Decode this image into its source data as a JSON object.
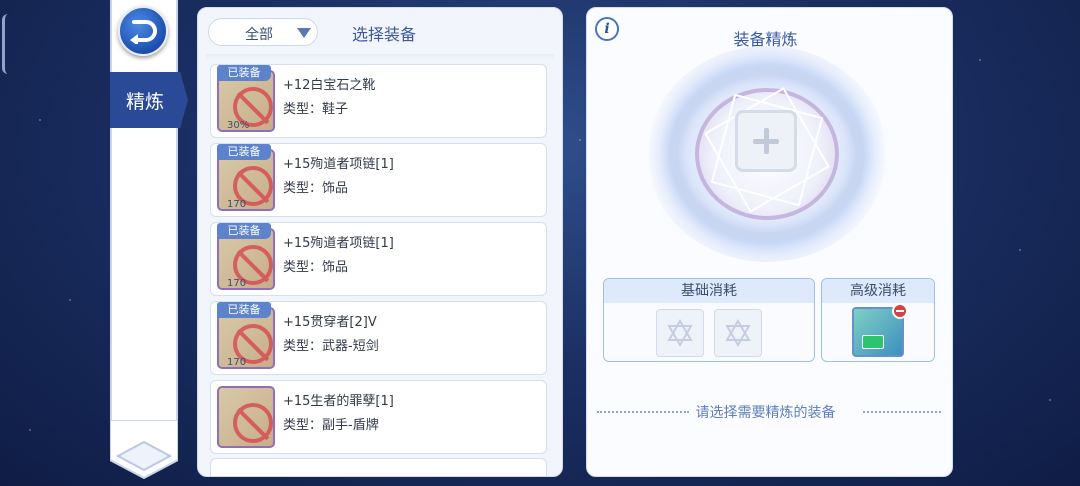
{
  "colors": {
    "accent": "#2a4a98",
    "panel_title": "#3b5a9e",
    "equipped_badge": "#5c83cc"
  },
  "sidebar": {
    "back_icon": "back-arrow-icon",
    "tab_label": "精炼"
  },
  "list": {
    "filter_value": "全部",
    "title": "选择装备",
    "items": [
      {
        "badge": "已装备",
        "name": "+12白宝石之靴",
        "type": "类型：鞋子",
        "level": "30%"
      },
      {
        "badge": "已装备",
        "name": "+15殉道者项链[1]",
        "type": "类型：饰品",
        "level": "170"
      },
      {
        "badge": "已装备",
        "name": "+15殉道者项链[1]",
        "type": "类型：饰品",
        "level": "170"
      },
      {
        "badge": "已装备",
        "name": "+15贯穿者[2]V",
        "type": "类型：武器-短剑",
        "level": "170"
      },
      {
        "badge": "",
        "name": "+15生者的罪孽[1]",
        "type": "类型：副手-盾牌",
        "level": ""
      }
    ]
  },
  "refine": {
    "title": "装备精炼",
    "info_icon": "i",
    "basic_cost_label": "基础消耗",
    "advanced_cost_label": "高级消耗",
    "hint": "请选择需要精炼的装备"
  }
}
